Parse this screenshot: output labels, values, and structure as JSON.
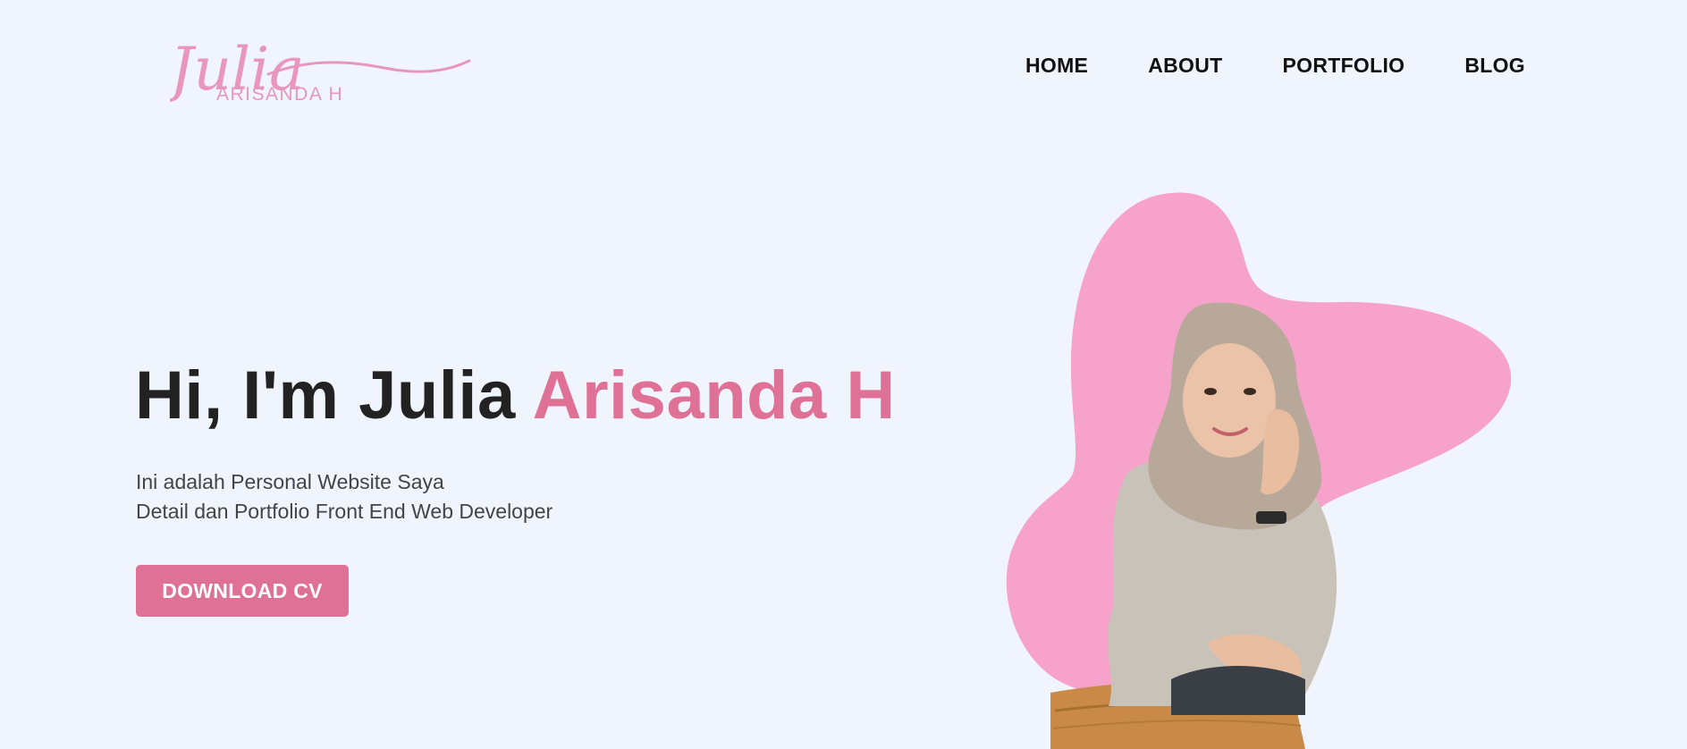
{
  "brand": {
    "logo_script": "Julia",
    "logo_sub": "ARISANDA H",
    "color": "#e896bb"
  },
  "nav": {
    "items": [
      {
        "label": "HOME"
      },
      {
        "label": "ABOUT"
      },
      {
        "label": "PORTFOLIO"
      },
      {
        "label": "BLOG"
      }
    ]
  },
  "hero": {
    "title_prefix": "Hi, I'm Julia ",
    "title_accent": "Arisanda H",
    "desc_line1": "Ini adalah Personal Website Saya",
    "desc_line2": "Detail dan Portfolio Front End Web Developer",
    "cta_label": "DOWNLOAD CV",
    "accent_color": "#df7196",
    "blob_color": "#f6a2ca",
    "image": "woman-in-hijab-portrait"
  },
  "colors": {
    "background": "#f0f4fc",
    "text_dark": "#222222"
  }
}
